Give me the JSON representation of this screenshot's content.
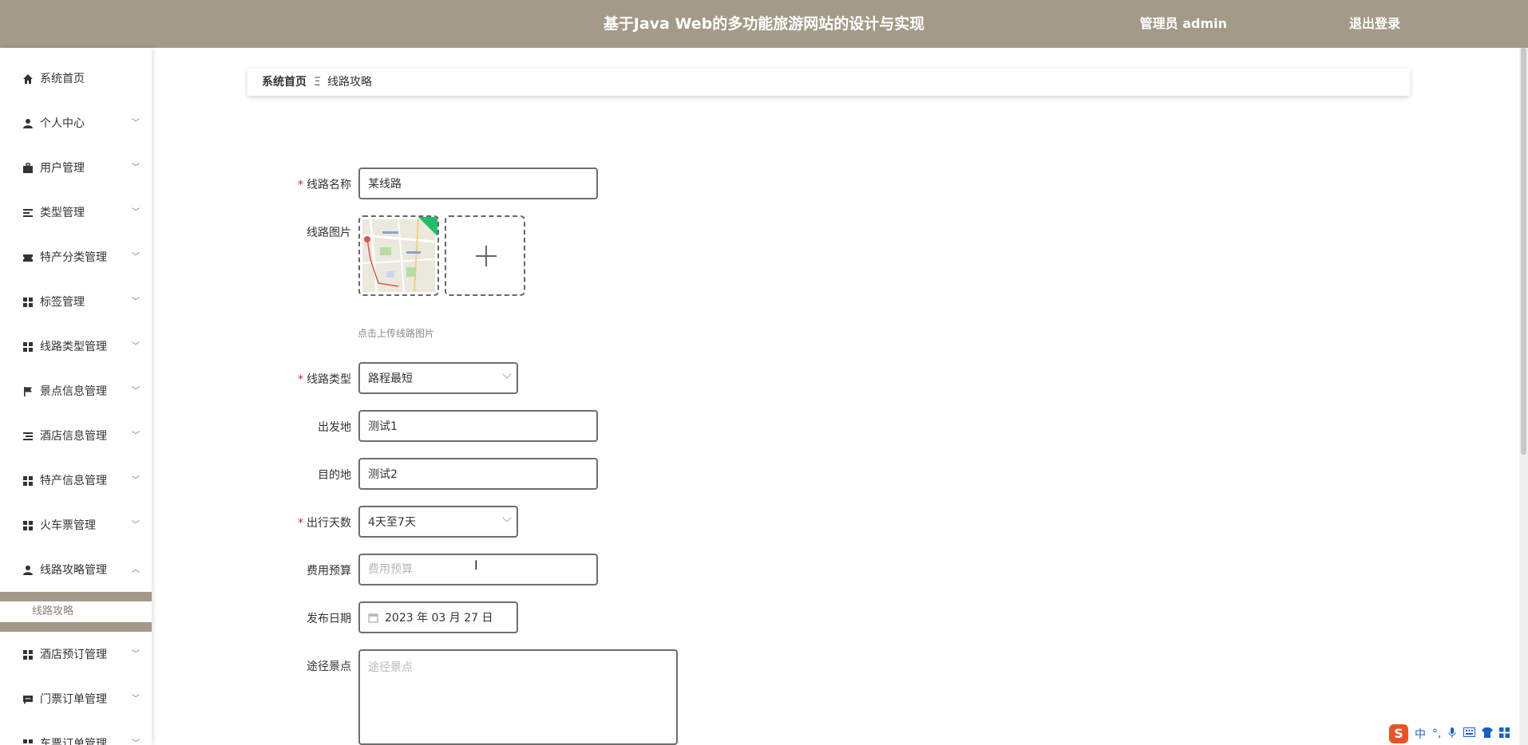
{
  "header": {
    "title": "基于Java Web的多功能旅游网站的设计与实现",
    "user": "管理员 admin",
    "logout": "退出登录"
  },
  "sidebar": {
    "items": [
      {
        "label": "系统首页",
        "icon": "home-icon"
      },
      {
        "label": "个人中心",
        "icon": "person-icon"
      },
      {
        "label": "用户管理",
        "icon": "briefcase-icon"
      },
      {
        "label": "类型管理",
        "icon": "list-icon"
      },
      {
        "label": "特产分类管理",
        "icon": "ticket-icon"
      },
      {
        "label": "标签管理",
        "icon": "grid-icon"
      },
      {
        "label": "线路类型管理",
        "icon": "grid-icon"
      },
      {
        "label": "景点信息管理",
        "icon": "flag-icon"
      },
      {
        "label": "酒店信息管理",
        "icon": "list-icon"
      },
      {
        "label": "特产信息管理",
        "icon": "grid-icon"
      },
      {
        "label": "火车票管理",
        "icon": "grid-icon"
      },
      {
        "label": "线路攻略管理",
        "icon": "person-icon"
      },
      {
        "label": "酒店预订管理",
        "icon": "grid-icon"
      },
      {
        "label": "门票订单管理",
        "icon": "chat-icon"
      },
      {
        "label": "车票订单管理",
        "icon": "grid-icon"
      }
    ],
    "sub_item": "线路攻略"
  },
  "breadcrumb": {
    "home": "系统首页",
    "separator": "Ξ",
    "current": "线路攻略"
  },
  "form": {
    "route_name": {
      "label": "线路名称",
      "value": "某线路",
      "required": true
    },
    "route_image": {
      "label": "线路图片",
      "hint": "点击上传线路图片"
    },
    "route_type": {
      "label": "线路类型",
      "value": "路程最短",
      "required": true
    },
    "departure": {
      "label": "出发地",
      "value": "测试1"
    },
    "destination": {
      "label": "目的地",
      "value": "测试2"
    },
    "travel_days": {
      "label": "出行天数",
      "value": "4天至7天",
      "required": true
    },
    "budget": {
      "label": "费用预算",
      "placeholder": "费用预算",
      "value": ""
    },
    "publish_date": {
      "label": "发布日期",
      "value": "2023 年 03 月 27 日"
    },
    "spots": {
      "label": "途径景点",
      "placeholder": "途径景点",
      "value": ""
    }
  },
  "tray": {
    "ime": "中",
    "logo": "S"
  },
  "colors": {
    "header": "#a39a87",
    "required": "#e02020",
    "badge": "#1fbf6a"
  }
}
